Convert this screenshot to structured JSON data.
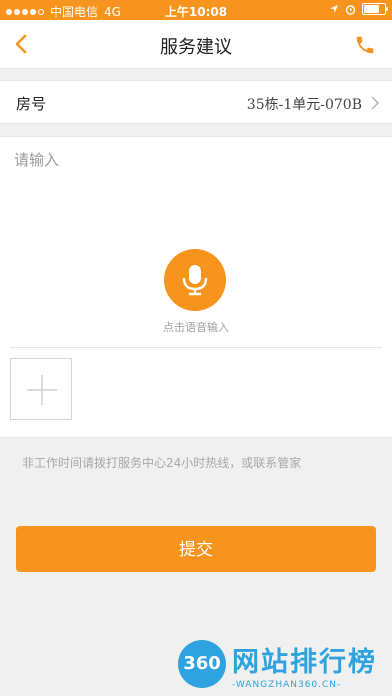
{
  "status_bar": {
    "carrier": "中国电信",
    "network": "4G",
    "time": "上午10:08"
  },
  "nav": {
    "title": "服务建议",
    "back_icon": "chevron-left-icon",
    "phone_icon": "phone-icon"
  },
  "room_row": {
    "label": "房号",
    "value": "35栋-1单元-070B"
  },
  "suggestion": {
    "placeholder": "请输入",
    "voice_label": "点击语音输入"
  },
  "hint": "非工作时间请拨打服务中心24小时热线，或联系管家",
  "submit_label": "提交",
  "watermark": {
    "logo_text": "360",
    "text": "网站排行榜",
    "sub": "-WANGZHAN360.CN-"
  },
  "colors": {
    "accent": "#f7941d",
    "background": "#f0f0f0"
  }
}
